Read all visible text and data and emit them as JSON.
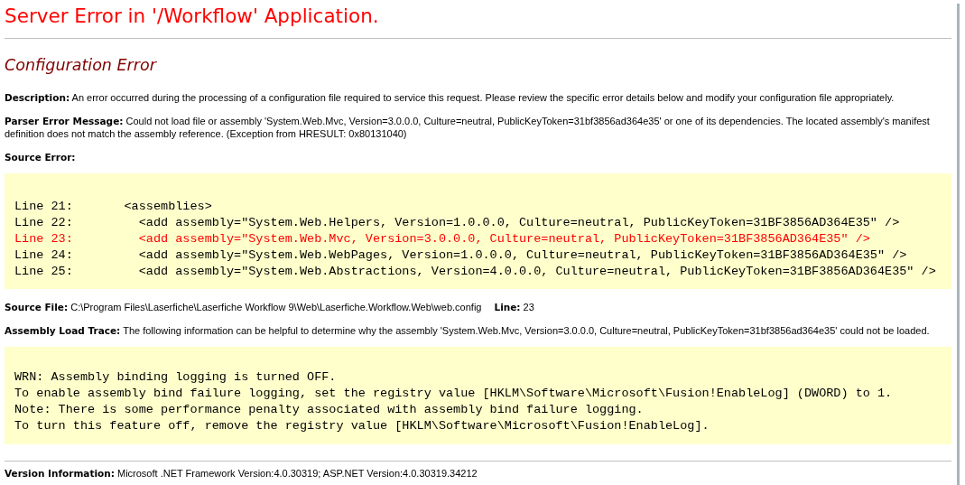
{
  "title": "Server Error in '/Workflow' Application.",
  "error_heading": "Configuration Error",
  "description": {
    "label": "Description:",
    "text": "An error occurred during the processing of a configuration file required to service this request. Please review the specific error details below and modify your configuration file appropriately."
  },
  "parser_error": {
    "label": "Parser Error Message:",
    "text": "Could not load file or assembly 'System.Web.Mvc, Version=3.0.0.0, Culture=neutral, PublicKeyToken=31bf3856ad364e35' or one of its dependencies. The located assembly's manifest definition does not match the assembly reference. (Exception from HRESULT: 0x80131040)"
  },
  "source_error": {
    "label": "Source Error:",
    "lines": [
      {
        "text": "Line 21:       <assemblies>",
        "highlighted": false
      },
      {
        "text": "Line 22:         <add assembly=\"System.Web.Helpers, Version=1.0.0.0, Culture=neutral, PublicKeyToken=31BF3856AD364E35\" />",
        "highlighted": false
      },
      {
        "text": "Line 23:         <add assembly=\"System.Web.Mvc, Version=3.0.0.0, Culture=neutral, PublicKeyToken=31BF3856AD364E35\" />",
        "highlighted": true
      },
      {
        "text": "Line 24:         <add assembly=\"System.Web.WebPages, Version=1.0.0.0, Culture=neutral, PublicKeyToken=31BF3856AD364E35\" />",
        "highlighted": false
      },
      {
        "text": "Line 25:         <add assembly=\"System.Web.Abstractions, Version=4.0.0.0, Culture=neutral, PublicKeyToken=31BF3856AD364E35\" />",
        "highlighted": false
      }
    ]
  },
  "source_file": {
    "label": "Source File:",
    "path": "C:\\Program Files\\Laserfiche\\Laserfiche Workflow 9\\Web\\Laserfiche.Workflow.Web\\web.config",
    "line_label": "Line:",
    "line": "23"
  },
  "assembly_load_trace": {
    "label": "Assembly Load Trace:",
    "text": "The following information can be helpful to determine why the assembly 'System.Web.Mvc, Version=3.0.0.0, Culture=neutral, PublicKeyToken=31bf3856ad364e35' could not be loaded.",
    "lines": [
      "WRN: Assembly binding logging is turned OFF.",
      "To enable assembly bind failure logging, set the registry value [HKLM\\Software\\Microsoft\\Fusion!EnableLog] (DWORD) to 1.",
      "Note: There is some performance penalty associated with assembly bind failure logging.",
      "To turn this feature off, remove the registry value [HKLM\\Software\\Microsoft\\Fusion!EnableLog]."
    ]
  },
  "version_info": {
    "label": "Version Information:",
    "text": "Microsoft .NET Framework Version:4.0.30319; ASP.NET Version:4.0.30319.34212"
  }
}
